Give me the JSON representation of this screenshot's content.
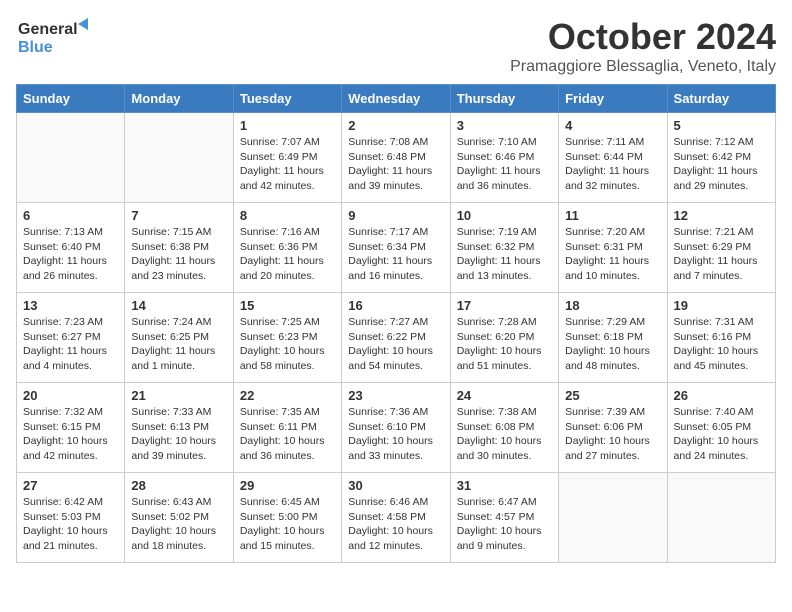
{
  "logo": {
    "text_general": "General",
    "text_blue": "Blue"
  },
  "title": "October 2024",
  "location": "Pramaggiore Blessaglia, Veneto, Italy",
  "days_of_week": [
    "Sunday",
    "Monday",
    "Tuesday",
    "Wednesday",
    "Thursday",
    "Friday",
    "Saturday"
  ],
  "weeks": [
    [
      {
        "day": "",
        "detail": ""
      },
      {
        "day": "",
        "detail": ""
      },
      {
        "day": "1",
        "detail": "Sunrise: 7:07 AM\nSunset: 6:49 PM\nDaylight: 11 hours\nand 42 minutes."
      },
      {
        "day": "2",
        "detail": "Sunrise: 7:08 AM\nSunset: 6:48 PM\nDaylight: 11 hours\nand 39 minutes."
      },
      {
        "day": "3",
        "detail": "Sunrise: 7:10 AM\nSunset: 6:46 PM\nDaylight: 11 hours\nand 36 minutes."
      },
      {
        "day": "4",
        "detail": "Sunrise: 7:11 AM\nSunset: 6:44 PM\nDaylight: 11 hours\nand 32 minutes."
      },
      {
        "day": "5",
        "detail": "Sunrise: 7:12 AM\nSunset: 6:42 PM\nDaylight: 11 hours\nand 29 minutes."
      }
    ],
    [
      {
        "day": "6",
        "detail": "Sunrise: 7:13 AM\nSunset: 6:40 PM\nDaylight: 11 hours\nand 26 minutes."
      },
      {
        "day": "7",
        "detail": "Sunrise: 7:15 AM\nSunset: 6:38 PM\nDaylight: 11 hours\nand 23 minutes."
      },
      {
        "day": "8",
        "detail": "Sunrise: 7:16 AM\nSunset: 6:36 PM\nDaylight: 11 hours\nand 20 minutes."
      },
      {
        "day": "9",
        "detail": "Sunrise: 7:17 AM\nSunset: 6:34 PM\nDaylight: 11 hours\nand 16 minutes."
      },
      {
        "day": "10",
        "detail": "Sunrise: 7:19 AM\nSunset: 6:32 PM\nDaylight: 11 hours\nand 13 minutes."
      },
      {
        "day": "11",
        "detail": "Sunrise: 7:20 AM\nSunset: 6:31 PM\nDaylight: 11 hours\nand 10 minutes."
      },
      {
        "day": "12",
        "detail": "Sunrise: 7:21 AM\nSunset: 6:29 PM\nDaylight: 11 hours\nand 7 minutes."
      }
    ],
    [
      {
        "day": "13",
        "detail": "Sunrise: 7:23 AM\nSunset: 6:27 PM\nDaylight: 11 hours\nand 4 minutes."
      },
      {
        "day": "14",
        "detail": "Sunrise: 7:24 AM\nSunset: 6:25 PM\nDaylight: 11 hours\nand 1 minute."
      },
      {
        "day": "15",
        "detail": "Sunrise: 7:25 AM\nSunset: 6:23 PM\nDaylight: 10 hours\nand 58 minutes."
      },
      {
        "day": "16",
        "detail": "Sunrise: 7:27 AM\nSunset: 6:22 PM\nDaylight: 10 hours\nand 54 minutes."
      },
      {
        "day": "17",
        "detail": "Sunrise: 7:28 AM\nSunset: 6:20 PM\nDaylight: 10 hours\nand 51 minutes."
      },
      {
        "day": "18",
        "detail": "Sunrise: 7:29 AM\nSunset: 6:18 PM\nDaylight: 10 hours\nand 48 minutes."
      },
      {
        "day": "19",
        "detail": "Sunrise: 7:31 AM\nSunset: 6:16 PM\nDaylight: 10 hours\nand 45 minutes."
      }
    ],
    [
      {
        "day": "20",
        "detail": "Sunrise: 7:32 AM\nSunset: 6:15 PM\nDaylight: 10 hours\nand 42 minutes."
      },
      {
        "day": "21",
        "detail": "Sunrise: 7:33 AM\nSunset: 6:13 PM\nDaylight: 10 hours\nand 39 minutes."
      },
      {
        "day": "22",
        "detail": "Sunrise: 7:35 AM\nSunset: 6:11 PM\nDaylight: 10 hours\nand 36 minutes."
      },
      {
        "day": "23",
        "detail": "Sunrise: 7:36 AM\nSunset: 6:10 PM\nDaylight: 10 hours\nand 33 minutes."
      },
      {
        "day": "24",
        "detail": "Sunrise: 7:38 AM\nSunset: 6:08 PM\nDaylight: 10 hours\nand 30 minutes."
      },
      {
        "day": "25",
        "detail": "Sunrise: 7:39 AM\nSunset: 6:06 PM\nDaylight: 10 hours\nand 27 minutes."
      },
      {
        "day": "26",
        "detail": "Sunrise: 7:40 AM\nSunset: 6:05 PM\nDaylight: 10 hours\nand 24 minutes."
      }
    ],
    [
      {
        "day": "27",
        "detail": "Sunrise: 6:42 AM\nSunset: 5:03 PM\nDaylight: 10 hours\nand 21 minutes."
      },
      {
        "day": "28",
        "detail": "Sunrise: 6:43 AM\nSunset: 5:02 PM\nDaylight: 10 hours\nand 18 minutes."
      },
      {
        "day": "29",
        "detail": "Sunrise: 6:45 AM\nSunset: 5:00 PM\nDaylight: 10 hours\nand 15 minutes."
      },
      {
        "day": "30",
        "detail": "Sunrise: 6:46 AM\nSunset: 4:58 PM\nDaylight: 10 hours\nand 12 minutes."
      },
      {
        "day": "31",
        "detail": "Sunrise: 6:47 AM\nSunset: 4:57 PM\nDaylight: 10 hours\nand 9 minutes."
      },
      {
        "day": "",
        "detail": ""
      },
      {
        "day": "",
        "detail": ""
      }
    ]
  ]
}
